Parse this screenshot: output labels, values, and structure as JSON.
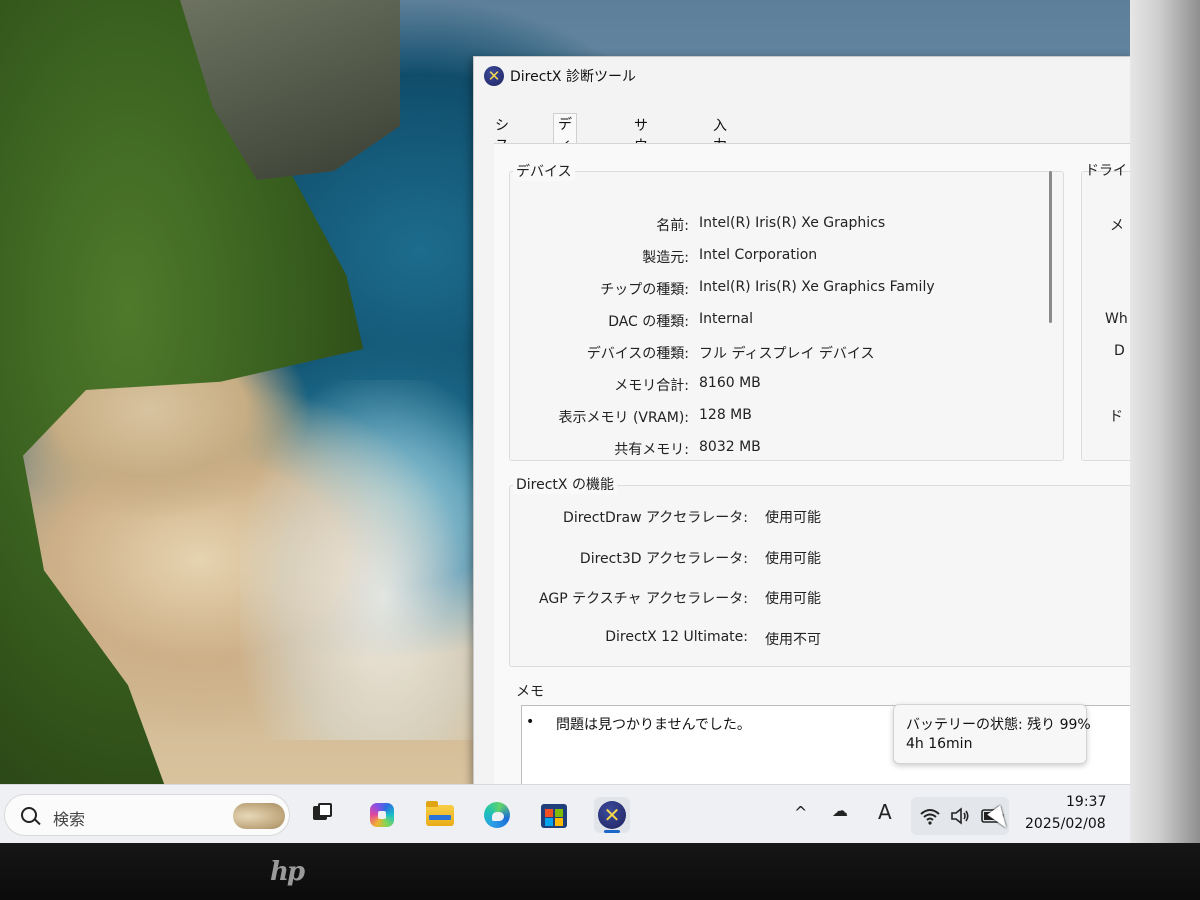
{
  "window": {
    "title": "DirectX 診断ツール",
    "tabs": [
      {
        "label": "システム"
      },
      {
        "label": "ディスプレイ"
      },
      {
        "label": "サウンド"
      },
      {
        "label": "入力"
      }
    ],
    "active_tab": "ディスプレイ"
  },
  "device": {
    "group_label": "デバイス",
    "rows": [
      {
        "label": "名前:",
        "value": "Intel(R) Iris(R) Xe Graphics"
      },
      {
        "label": "製造元:",
        "value": "Intel Corporation"
      },
      {
        "label": "チップの種類:",
        "value": "Intel(R) Iris(R) Xe Graphics Family"
      },
      {
        "label": "DAC の種類:",
        "value": "Internal"
      },
      {
        "label": "デバイスの種類:",
        "value": "フル ディスプレイ デバイス"
      },
      {
        "label": "メモリ合計:",
        "value": "8160 MB"
      },
      {
        "label": "表示メモリ (VRAM):",
        "value": "128 MB"
      },
      {
        "label": "共有メモリ:",
        "value": "8032 MB"
      }
    ]
  },
  "driver_partial": {
    "group_label": "ドライ",
    "fragments": [
      "メ",
      "Wh",
      "D",
      "ド"
    ]
  },
  "features": {
    "group_label": "DirectX の機能",
    "rows": [
      {
        "label": "DirectDraw アクセラレータ:",
        "value": "使用可能"
      },
      {
        "label": "Direct3D アクセラレータ:",
        "value": "使用可能"
      },
      {
        "label": "AGP テクスチャ アクセラレータ:",
        "value": "使用可能"
      },
      {
        "label": "DirectX 12 Ultimate:",
        "value": "使用不可"
      }
    ]
  },
  "notes": {
    "group_label": "メモ",
    "bullet": "•",
    "items": [
      "問題は見つかりませんでした。"
    ]
  },
  "tooltip": {
    "line1": "バッテリーの状態: 残り 99%",
    "line2": "4h 16min"
  },
  "taskbar": {
    "search_placeholder": "検索",
    "apps": [
      "task-view",
      "copilot",
      "file-explorer",
      "edge",
      "microsoft-store",
      "directx-diagnostic"
    ],
    "active_app": "directx-diagnostic",
    "tray_overflow": "^",
    "input_indicator": "A",
    "time": "19:37",
    "date": "2025/02/08"
  },
  "device_brand": "hp"
}
